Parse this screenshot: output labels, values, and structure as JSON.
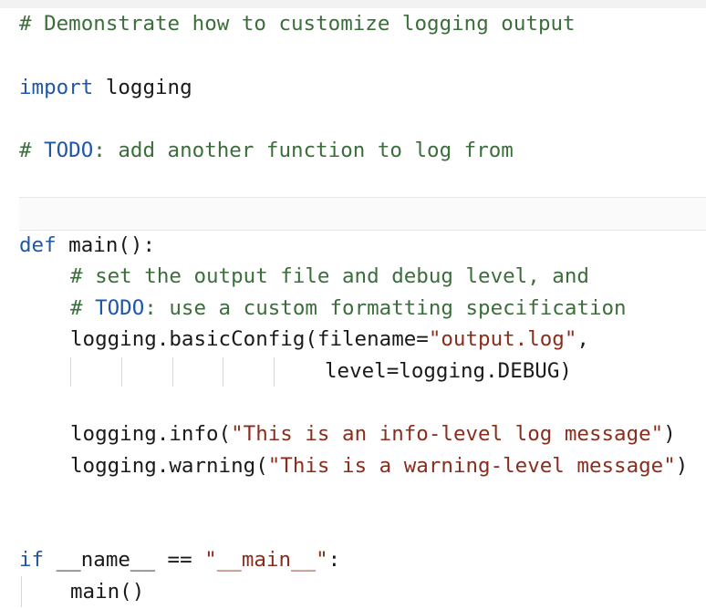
{
  "editor": {
    "lines": [
      {
        "id": "comment-demo",
        "tokens": [
          {
            "t": "# Demonstrate how to customize logging output",
            "k": "comment"
          }
        ]
      },
      {
        "id": "import-line",
        "tokens": [
          {
            "t": "import",
            "k": "kw"
          },
          {
            "t": " logging",
            "k": "plain"
          }
        ]
      },
      {
        "id": "todo-add-function",
        "tokens": [
          {
            "t": "# ",
            "k": "comment"
          },
          {
            "t": "TODO",
            "k": "kw"
          },
          {
            "t": ": add another function to log from",
            "k": "comment"
          }
        ]
      },
      {
        "id": "def-main",
        "tokens": [
          {
            "t": "def",
            "k": "kw"
          },
          {
            "t": " main():",
            "k": "plain"
          }
        ]
      },
      {
        "id": "comment-set-output",
        "tokens": [
          {
            "t": "# set the output file and debug level, and",
            "k": "comment"
          }
        ]
      },
      {
        "id": "todo-format-spec",
        "tokens": [
          {
            "t": "# ",
            "k": "comment"
          },
          {
            "t": "TODO",
            "k": "kw"
          },
          {
            "t": ": use a custom formatting specification",
            "k": "comment"
          }
        ]
      },
      {
        "id": "basicconfig-call",
        "tokens": [
          {
            "t": "logging.basicConfig(filename=",
            "k": "plain"
          },
          {
            "t": "\"output.log\"",
            "k": "str"
          },
          {
            "t": ",",
            "k": "plain"
          }
        ]
      },
      {
        "id": "level-arg",
        "tokens": [
          {
            "t": "level=logging.DEBUG)",
            "k": "plain"
          }
        ]
      },
      {
        "id": "info-call",
        "tokens": [
          {
            "t": "logging.info(",
            "k": "plain"
          },
          {
            "t": "\"This is an info-level log message\"",
            "k": "str"
          },
          {
            "t": ")",
            "k": "plain"
          }
        ]
      },
      {
        "id": "warning-call",
        "tokens": [
          {
            "t": "logging.warning(",
            "k": "plain"
          },
          {
            "t": "\"This is a warning-level message\"",
            "k": "str"
          },
          {
            "t": ")",
            "k": "plain"
          }
        ]
      },
      {
        "id": "if-name-main",
        "tokens": [
          {
            "t": "if",
            "k": "kw"
          },
          {
            "t": " __name__ == ",
            "k": "plain"
          },
          {
            "t": "\"__main__\"",
            "k": "str"
          },
          {
            "t": ":",
            "k": "plain"
          }
        ]
      },
      {
        "id": "main-call",
        "tokens": [
          {
            "t": "main()",
            "k": "plain"
          }
        ]
      }
    ]
  },
  "colors": {
    "comment": "#3b6e3b",
    "keyword": "#1f57a8",
    "string": "#8b2d1d",
    "plain": "#1a1a1a"
  }
}
